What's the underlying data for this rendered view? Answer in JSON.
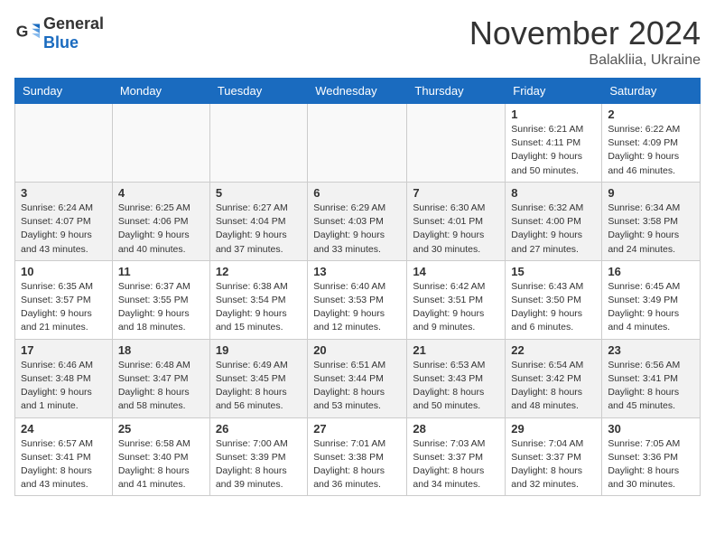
{
  "header": {
    "logo_general": "General",
    "logo_blue": "Blue",
    "month_title": "November 2024",
    "location": "Balakliia, Ukraine"
  },
  "days_of_week": [
    "Sunday",
    "Monday",
    "Tuesday",
    "Wednesday",
    "Thursday",
    "Friday",
    "Saturday"
  ],
  "weeks": [
    [
      {
        "day": "",
        "detail": ""
      },
      {
        "day": "",
        "detail": ""
      },
      {
        "day": "",
        "detail": ""
      },
      {
        "day": "",
        "detail": ""
      },
      {
        "day": "",
        "detail": ""
      },
      {
        "day": "1",
        "detail": "Sunrise: 6:21 AM\nSunset: 4:11 PM\nDaylight: 9 hours and 50 minutes."
      },
      {
        "day": "2",
        "detail": "Sunrise: 6:22 AM\nSunset: 4:09 PM\nDaylight: 9 hours and 46 minutes."
      }
    ],
    [
      {
        "day": "3",
        "detail": "Sunrise: 6:24 AM\nSunset: 4:07 PM\nDaylight: 9 hours and 43 minutes."
      },
      {
        "day": "4",
        "detail": "Sunrise: 6:25 AM\nSunset: 4:06 PM\nDaylight: 9 hours and 40 minutes."
      },
      {
        "day": "5",
        "detail": "Sunrise: 6:27 AM\nSunset: 4:04 PM\nDaylight: 9 hours and 37 minutes."
      },
      {
        "day": "6",
        "detail": "Sunrise: 6:29 AM\nSunset: 4:03 PM\nDaylight: 9 hours and 33 minutes."
      },
      {
        "day": "7",
        "detail": "Sunrise: 6:30 AM\nSunset: 4:01 PM\nDaylight: 9 hours and 30 minutes."
      },
      {
        "day": "8",
        "detail": "Sunrise: 6:32 AM\nSunset: 4:00 PM\nDaylight: 9 hours and 27 minutes."
      },
      {
        "day": "9",
        "detail": "Sunrise: 6:34 AM\nSunset: 3:58 PM\nDaylight: 9 hours and 24 minutes."
      }
    ],
    [
      {
        "day": "10",
        "detail": "Sunrise: 6:35 AM\nSunset: 3:57 PM\nDaylight: 9 hours and 21 minutes."
      },
      {
        "day": "11",
        "detail": "Sunrise: 6:37 AM\nSunset: 3:55 PM\nDaylight: 9 hours and 18 minutes."
      },
      {
        "day": "12",
        "detail": "Sunrise: 6:38 AM\nSunset: 3:54 PM\nDaylight: 9 hours and 15 minutes."
      },
      {
        "day": "13",
        "detail": "Sunrise: 6:40 AM\nSunset: 3:53 PM\nDaylight: 9 hours and 12 minutes."
      },
      {
        "day": "14",
        "detail": "Sunrise: 6:42 AM\nSunset: 3:51 PM\nDaylight: 9 hours and 9 minutes."
      },
      {
        "day": "15",
        "detail": "Sunrise: 6:43 AM\nSunset: 3:50 PM\nDaylight: 9 hours and 6 minutes."
      },
      {
        "day": "16",
        "detail": "Sunrise: 6:45 AM\nSunset: 3:49 PM\nDaylight: 9 hours and 4 minutes."
      }
    ],
    [
      {
        "day": "17",
        "detail": "Sunrise: 6:46 AM\nSunset: 3:48 PM\nDaylight: 9 hours and 1 minute."
      },
      {
        "day": "18",
        "detail": "Sunrise: 6:48 AM\nSunset: 3:47 PM\nDaylight: 8 hours and 58 minutes."
      },
      {
        "day": "19",
        "detail": "Sunrise: 6:49 AM\nSunset: 3:45 PM\nDaylight: 8 hours and 56 minutes."
      },
      {
        "day": "20",
        "detail": "Sunrise: 6:51 AM\nSunset: 3:44 PM\nDaylight: 8 hours and 53 minutes."
      },
      {
        "day": "21",
        "detail": "Sunrise: 6:53 AM\nSunset: 3:43 PM\nDaylight: 8 hours and 50 minutes."
      },
      {
        "day": "22",
        "detail": "Sunrise: 6:54 AM\nSunset: 3:42 PM\nDaylight: 8 hours and 48 minutes."
      },
      {
        "day": "23",
        "detail": "Sunrise: 6:56 AM\nSunset: 3:41 PM\nDaylight: 8 hours and 45 minutes."
      }
    ],
    [
      {
        "day": "24",
        "detail": "Sunrise: 6:57 AM\nSunset: 3:41 PM\nDaylight: 8 hours and 43 minutes."
      },
      {
        "day": "25",
        "detail": "Sunrise: 6:58 AM\nSunset: 3:40 PM\nDaylight: 8 hours and 41 minutes."
      },
      {
        "day": "26",
        "detail": "Sunrise: 7:00 AM\nSunset: 3:39 PM\nDaylight: 8 hours and 39 minutes."
      },
      {
        "day": "27",
        "detail": "Sunrise: 7:01 AM\nSunset: 3:38 PM\nDaylight: 8 hours and 36 minutes."
      },
      {
        "day": "28",
        "detail": "Sunrise: 7:03 AM\nSunset: 3:37 PM\nDaylight: 8 hours and 34 minutes."
      },
      {
        "day": "29",
        "detail": "Sunrise: 7:04 AM\nSunset: 3:37 PM\nDaylight: 8 hours and 32 minutes."
      },
      {
        "day": "30",
        "detail": "Sunrise: 7:05 AM\nSunset: 3:36 PM\nDaylight: 8 hours and 30 minutes."
      }
    ]
  ]
}
